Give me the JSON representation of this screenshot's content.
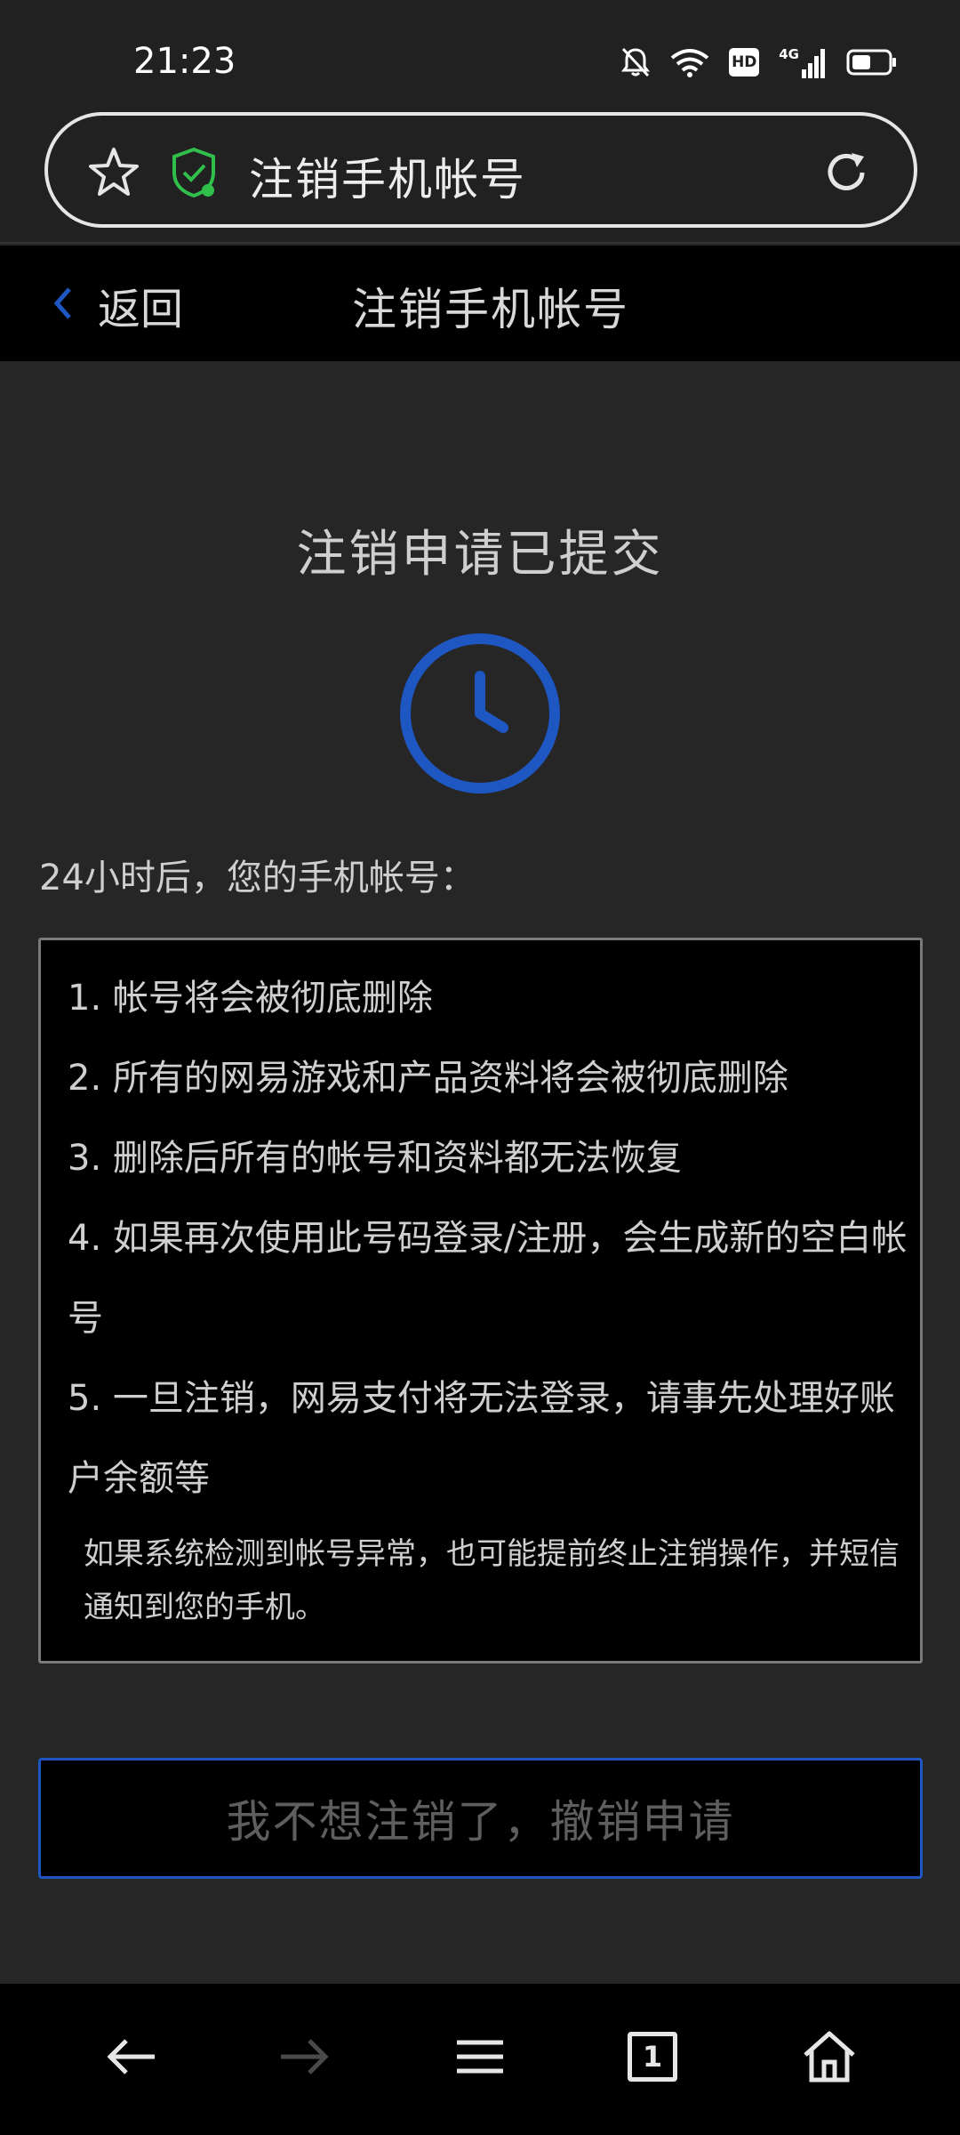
{
  "status_bar": {
    "time": "21:23",
    "icons": [
      "bell-muted-icon",
      "wifi-icon",
      "hd-icon",
      "signal-4g-icon",
      "battery-icon"
    ],
    "hd_label": "HD",
    "network_label": "4G"
  },
  "browser": {
    "url_title": "注销手机帐号",
    "icons": [
      "star-icon",
      "shield-check-icon",
      "refresh-icon"
    ]
  },
  "header": {
    "back_label": "返回",
    "title": "注销手机帐号"
  },
  "main": {
    "status_heading": "注销申请已提交",
    "intro": "24小时后，您的手机帐号：",
    "notice_items": [
      "1. 帐号将会被彻底删除",
      "2. 所有的网易游戏和产品资料将会被彻底删除",
      "3. 删除后所有的帐号和资料都无法恢复",
      "4. 如果再次使用此号码登录/注册，会生成新的空白帐号",
      "5. 一旦注销，网易支付将无法登录，请事先处理好账户余额等"
    ],
    "footnote": "如果系统检测到帐号异常，也可能提前终止注销操作，并短信通知到您的手机。",
    "cancel_button": "我不想注销了，撤销申请"
  },
  "bottom_nav": {
    "icons": [
      "arrow-left-icon",
      "arrow-right-icon",
      "menu-icon",
      "tabs-icon",
      "home-icon"
    ],
    "tab_count": "1"
  },
  "colors": {
    "accent_blue": "#1e56c2",
    "shield_green": "#2fbf4a",
    "background": "#262626"
  }
}
